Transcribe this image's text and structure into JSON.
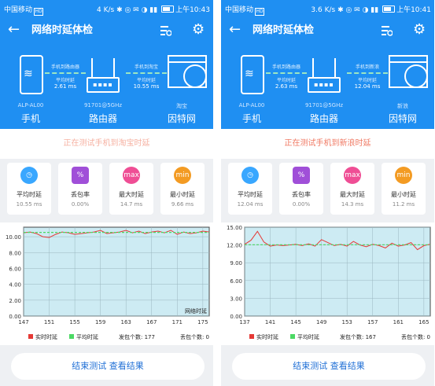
{
  "panels": [
    {
      "status": {
        "carrier": "中国移动",
        "carrier_badge": "HD",
        "speed": "4 K/s",
        "battery": "",
        "time": "上午10:43"
      },
      "title": "网络时延体检",
      "phone_name": "ALP-AL00",
      "phone_label": "手机",
      "router_name": "91701@5GHz",
      "router_label": "路由器",
      "target_name": "淘宝",
      "target_label": "因特网",
      "link1": {
        "title": "手机到路由器",
        "sub": "平均时延",
        "value": "2.61 ms"
      },
      "link2": {
        "title": "手机到淘宝",
        "sub": "平均时延",
        "value": "10.55 ms"
      },
      "progress": "正在测试手机到淘宝时延",
      "stats": [
        {
          "icon": "speed-icon",
          "label": "平均时延",
          "value": "10.55 ms",
          "color": "#39a7ff"
        },
        {
          "icon": "percent-icon",
          "label": "丢包率",
          "value": "0.00%",
          "color": "#a04fd8"
        },
        {
          "icon": "max-icon",
          "label": "最大时延",
          "value": "14.7 ms",
          "color": "#ef4e95"
        },
        {
          "icon": "min-icon",
          "label": "最小时延",
          "value": "9.66 ms",
          "color": "#f39b23"
        }
      ],
      "chart_data": {
        "type": "line",
        "title": "网络时延",
        "x_ticks": [
          "147",
          "151",
          "155",
          "159",
          "163",
          "167",
          "171",
          "175"
        ],
        "y_ticks": [
          "0.00",
          "2.00",
          "4.00",
          "6.00",
          "8.00",
          "10.00"
        ],
        "ylim": [
          0,
          11.2
        ],
        "x": [
          147,
          148,
          149,
          150,
          151,
          152,
          153,
          154,
          155,
          156,
          157,
          158,
          159,
          160,
          161,
          162,
          163,
          164,
          165,
          166,
          167,
          168,
          169,
          170,
          171,
          172,
          173,
          174,
          175,
          176
        ],
        "series": [
          {
            "name": "实时时延",
            "color": "#e53935",
            "values": [
              10.5,
              10.6,
              10.4,
              10.0,
              9.9,
              10.3,
              10.6,
              10.5,
              10.3,
              10.4,
              10.5,
              10.6,
              10.8,
              10.4,
              10.5,
              10.6,
              10.8,
              10.5,
              10.7,
              10.4,
              10.6,
              10.7,
              10.5,
              10.8,
              10.3,
              10.6,
              10.4,
              10.5,
              10.7,
              10.6
            ]
          },
          {
            "name": "平均时延",
            "color": "#4cd964",
            "values": [
              10.55,
              10.55,
              10.55,
              10.55,
              10.55,
              10.55,
              10.55,
              10.55,
              10.55,
              10.55,
              10.55,
              10.55,
              10.55,
              10.55,
              10.55,
              10.55,
              10.55,
              10.55,
              10.55,
              10.55,
              10.55,
              10.55,
              10.55,
              10.55,
              10.55,
              10.55,
              10.55,
              10.55,
              10.55,
              10.55
            ]
          }
        ],
        "sent_label": "发包个数: 177",
        "lost_label": "丢包个数: 0"
      },
      "button": "结束测试  查看结果"
    },
    {
      "status": {
        "carrier": "中国移动",
        "carrier_badge": "HD",
        "speed": "3.6 K/s",
        "battery": "",
        "time": "上午10:41"
      },
      "title": "网络时延体检",
      "phone_name": "ALP-AL00",
      "phone_label": "手机",
      "router_name": "91701@5GHz",
      "router_label": "路由器",
      "target_name": "新浪",
      "target_label": "因特网",
      "link1": {
        "title": "手机到路由器",
        "sub": "平均时延",
        "value": "2.63 ms"
      },
      "link2": {
        "title": "手机到新浪",
        "sub": "平均时延",
        "value": "12.04 ms"
      },
      "progress": "正在测试手机到新浪时延",
      "stats": [
        {
          "icon": "speed-icon",
          "label": "平均时延",
          "value": "12.04 ms",
          "color": "#39a7ff"
        },
        {
          "icon": "percent-icon",
          "label": "丢包率",
          "value": "0.00%",
          "color": "#a04fd8"
        },
        {
          "icon": "max-icon",
          "label": "最大时延",
          "value": "14.3 ms",
          "color": "#ef4e95"
        },
        {
          "icon": "min-icon",
          "label": "最小时延",
          "value": "11.2 ms",
          "color": "#f39b23"
        }
      ],
      "chart_data": {
        "type": "line",
        "title": "",
        "x_ticks": [
          "137",
          "141",
          "145",
          "149",
          "153",
          "157",
          "161",
          "165"
        ],
        "y_ticks": [
          "0.00",
          "3.00",
          "6.00",
          "9.00",
          "12.00",
          "15.00"
        ],
        "ylim": [
          0,
          15
        ],
        "x": [
          137,
          138,
          139,
          140,
          141,
          142,
          143,
          144,
          145,
          146,
          147,
          148,
          149,
          150,
          151,
          152,
          153,
          154,
          155,
          156,
          157,
          158,
          159,
          160,
          161,
          162,
          163,
          164,
          165,
          166
        ],
        "series": [
          {
            "name": "实时时延",
            "color": "#e53935",
            "values": [
              12.1,
              12.8,
              14.3,
              12.5,
              11.8,
              12.0,
              11.9,
              12.0,
              12.1,
              11.9,
              12.2,
              11.8,
              12.9,
              12.4,
              11.9,
              12.1,
              11.8,
              12.6,
              12.0,
              11.7,
              12.1,
              11.9,
              11.5,
              12.3,
              11.8,
              12.0,
              12.4,
              11.2,
              11.9,
              12.1
            ]
          },
          {
            "name": "平均时延",
            "color": "#4cd964",
            "values": [
              12.04,
              12.04,
              12.04,
              12.04,
              12.04,
              12.04,
              12.04,
              12.04,
              12.04,
              12.04,
              12.04,
              12.04,
              12.04,
              12.04,
              12.04,
              12.04,
              12.04,
              12.04,
              12.04,
              12.04,
              12.04,
              12.04,
              12.04,
              12.04,
              12.04,
              12.04,
              12.04,
              12.04,
              12.04,
              12.04
            ]
          }
        ],
        "sent_label": "发包个数: 167",
        "lost_label": "丢包个数: 0"
      },
      "button": "结束测试  查看结果"
    }
  ]
}
